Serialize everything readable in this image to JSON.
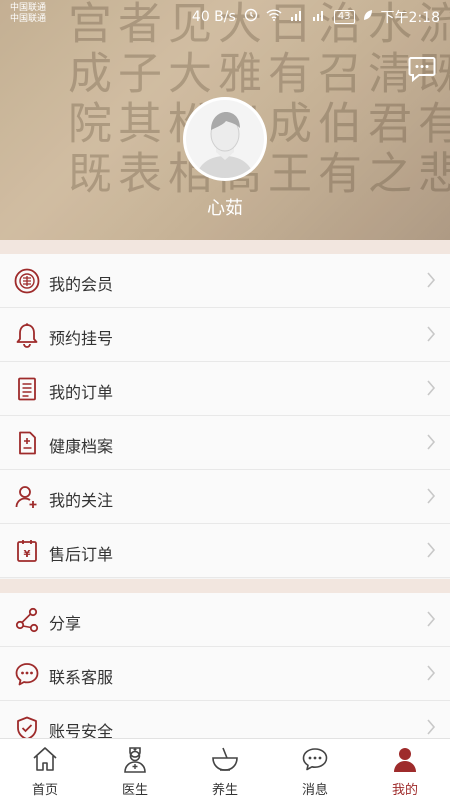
{
  "status_bar": {
    "carrier1": "中国联通",
    "carrier2": "中国联通",
    "speed": "40 B/s",
    "battery": "43",
    "time": "下午2:18"
  },
  "header": {
    "username": "心茹",
    "background_text": "流既有悲\n水清君之\n治召伯有\n日有成王\n大雅出高\n见大松相\n者子其表\n宫成院既"
  },
  "menu_group_1": [
    {
      "label": "我的会员",
      "icon": "membership-seal-icon"
    },
    {
      "label": "预约挂号",
      "icon": "bell-icon"
    },
    {
      "label": "我的订单",
      "icon": "order-list-icon"
    },
    {
      "label": "健康档案",
      "icon": "health-record-icon"
    },
    {
      "label": "我的关注",
      "icon": "user-follow-icon"
    },
    {
      "label": "售后订单",
      "icon": "after-sale-icon"
    }
  ],
  "menu_group_2": [
    {
      "label": "分享",
      "icon": "share-icon"
    },
    {
      "label": "联系客服",
      "icon": "customer-service-icon"
    },
    {
      "label": "账号安全",
      "icon": "shield-check-icon"
    }
  ],
  "tabs": [
    {
      "label": "首页",
      "icon": "home-icon"
    },
    {
      "label": "医生",
      "icon": "doctor-icon"
    },
    {
      "label": "养生",
      "icon": "bowl-icon"
    },
    {
      "label": "消息",
      "icon": "message-icon"
    },
    {
      "label": "我的",
      "icon": "person-icon",
      "active": true
    }
  ],
  "colors": {
    "accent": "#9e2b2b",
    "separator": "#f2e6df"
  }
}
